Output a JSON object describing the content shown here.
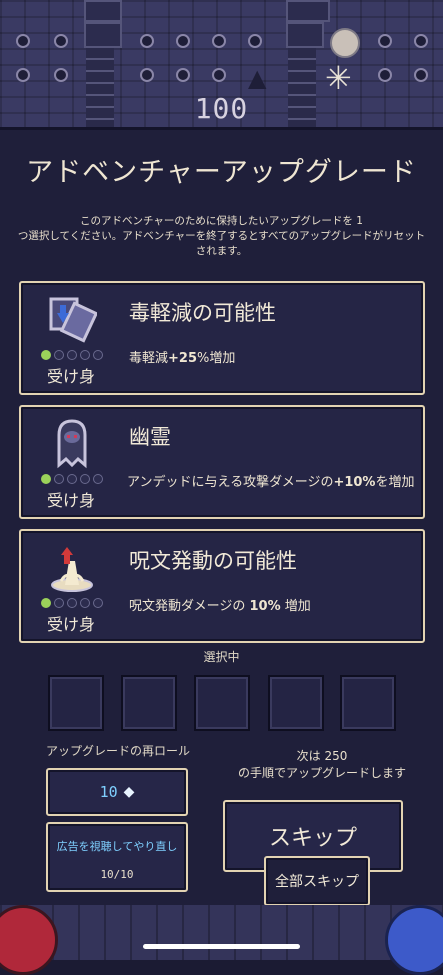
{
  "hud": {
    "counter": "100"
  },
  "dialog": {
    "title": "アドベンチャーアップグレード",
    "description_line1": "このアドベンチャーのために保持したいアップグレードを 1",
    "description_line2": "つ選択してください。アドベンチャーを終了するとすべてのアップグレードがリセットされます。"
  },
  "cards": [
    {
      "name": "毒軽減の可能性",
      "effect_pre": "毒軽減",
      "effect_bold": "+25",
      "effect_post": "%増加",
      "type": "受け身",
      "level": 1,
      "max_level": 5,
      "icon": "poison-shield-icon"
    },
    {
      "name": "幽霊",
      "effect_pre": "アンデッドに与える攻撃ダメージの",
      "effect_bold": "+10%",
      "effect_post": "を増加",
      "type": "受け身",
      "level": 1,
      "max_level": 5,
      "icon": "ghost-icon"
    },
    {
      "name": "呪文発動の可能性",
      "effect_pre": "呪文発動ダメージの ",
      "effect_bold": "10%",
      "effect_post": " 増加",
      "type": "受け身",
      "level": 1,
      "max_level": 5,
      "icon": "spell-cast-icon"
    }
  ],
  "selection": {
    "label": "選択中",
    "slot_count": 5
  },
  "reroll": {
    "label": "アップグレードの再ロール",
    "cost": "10",
    "currency_icon": "gem-icon"
  },
  "ad": {
    "label": "広告を視聴してやり直し",
    "count": "10/10"
  },
  "next": {
    "line1": "次は 250",
    "line2": "の手順でアップグレードします"
  },
  "buttons": {
    "skip": "スキップ",
    "skip_all": "全部スキップ"
  },
  "colors": {
    "accent_blue": "#7fd0ff",
    "pip_active": "#9bd25a",
    "border": "#e2d3b2"
  }
}
